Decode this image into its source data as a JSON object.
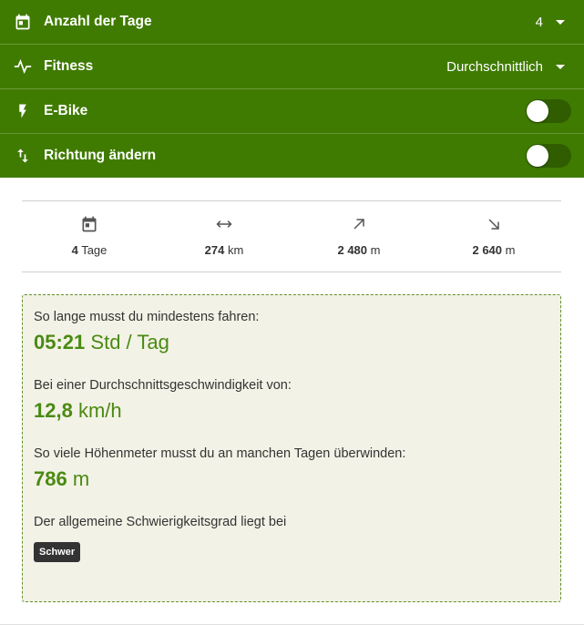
{
  "settings": {
    "days": {
      "label": "Anzahl der Tage",
      "value": "4"
    },
    "fitness": {
      "label": "Fitness",
      "value": "Durchschnittlich"
    },
    "ebike": {
      "label": "E-Bike",
      "on": false
    },
    "reverse": {
      "label": "Richtung ändern",
      "on": false
    }
  },
  "stats": {
    "days": {
      "value": "4",
      "unit": "Tage"
    },
    "distance": {
      "value": "274",
      "unit": "km"
    },
    "ascent": {
      "value": "2 480",
      "unit": "m"
    },
    "descent": {
      "value": "2 640",
      "unit": "m"
    }
  },
  "panel": {
    "duration_question": "So lange musst du mindestens fahren:",
    "duration_value": "05:21",
    "duration_unit": "Std / Tag",
    "speed_question": "Bei einer Durchschnittsgeschwindigkeit von:",
    "speed_value": "12,8",
    "speed_unit": "km/h",
    "elevation_question": "So viele Höhenmeter musst du an manchen Tagen überwinden:",
    "elevation_value": "786",
    "elevation_unit": "m",
    "difficulty_question": "Der allgemeine Schwierigkeitsgrad liegt bei",
    "difficulty_badge": "Schwer"
  },
  "colors": {
    "header_green": "#3f7b00",
    "accent_green": "#4a8a12",
    "panel_bg": "#f3f2e6"
  }
}
